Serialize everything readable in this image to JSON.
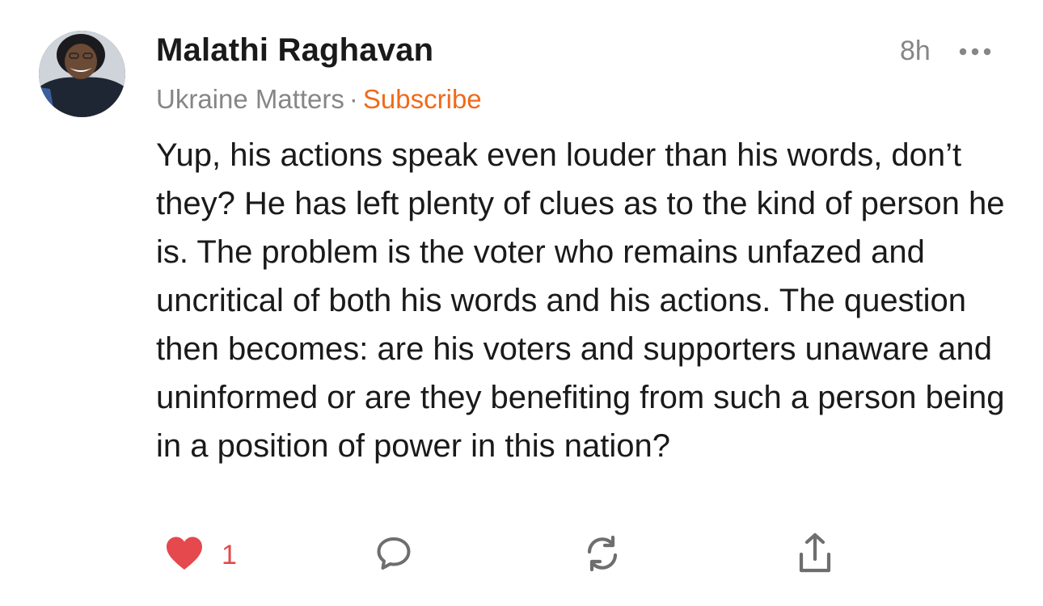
{
  "comment": {
    "author": "Malathi Raghavan",
    "publication": "Ukraine Matters",
    "separator": "·",
    "subscribe_label": "Subscribe",
    "timestamp": "8h",
    "more_icon": "more-horizontal-icon",
    "body": "Yup, his actions speak even louder than his words, don’t they? He has left plenty of clues as to the kind of person he is. The problem is the voter who remains unfazed and uncritical of both his words and his actions. The question then becomes: are his voters and supporters unaware and uninformed or are they benefiting from such a person being in a position of power in this nation?"
  },
  "actions": {
    "like_icon": "heart-icon",
    "like_count": "1",
    "comment_icon": "comment-icon",
    "restack_icon": "restack-icon",
    "share_icon": "share-icon"
  },
  "colors": {
    "accent": "#f06a1a",
    "like": "#e5484d",
    "muted": "#868686",
    "text": "#1a1a1a"
  }
}
